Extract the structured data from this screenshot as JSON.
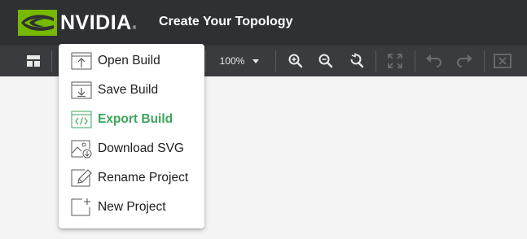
{
  "header": {
    "brand": "NVIDIA",
    "brand_mark": "®",
    "title": "Create Your Topology",
    "logo_icon": "nvidia-eye-icon"
  },
  "toolbar": {
    "zoom_value": "100%",
    "buttons": [
      {
        "name": "layout-icon"
      },
      {
        "name": "zoom-in-icon"
      },
      {
        "name": "zoom-out-icon"
      },
      {
        "name": "zoom-reset-icon"
      },
      {
        "name": "fit-screen-icon"
      },
      {
        "name": "undo-icon"
      },
      {
        "name": "redo-icon"
      },
      {
        "name": "clear-icon"
      }
    ]
  },
  "menu": {
    "items": [
      {
        "label": "Open Build",
        "icon": "open-build-icon",
        "active": false
      },
      {
        "label": "Save Build",
        "icon": "save-build-icon",
        "active": false
      },
      {
        "label": "Export Build",
        "icon": "export-build-icon",
        "active": true
      },
      {
        "label": "Download SVG",
        "icon": "download-svg-icon",
        "active": false
      },
      {
        "label": "Rename Project",
        "icon": "rename-project-icon",
        "active": false
      },
      {
        "label": "New Project",
        "icon": "new-project-icon",
        "active": false
      }
    ]
  },
  "colors": {
    "header_bg": "#2f3034",
    "toolbar_bg": "#3a3b3f",
    "accent_green": "#76b900",
    "active_text": "#3aa55b",
    "canvas_bg": "#f4f4f4"
  }
}
